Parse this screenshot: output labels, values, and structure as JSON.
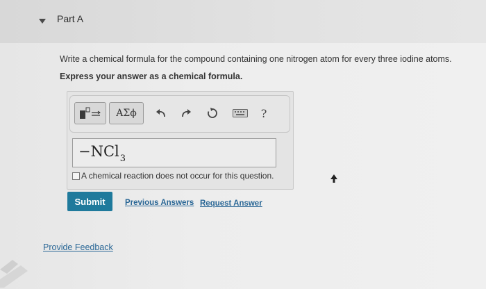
{
  "part": {
    "title": "Part A"
  },
  "question": {
    "text": "Write a chemical formula for the compound containing one nitrogen atom for every three iodine atoms.",
    "instruction": "Express your answer as a chemical formula."
  },
  "toolbar": {
    "symbols_label": "ΑΣϕ",
    "help_label": "?"
  },
  "answer": {
    "prefix": "−NCl",
    "subscript": "3"
  },
  "no_reaction_label": "A chemical reaction does not occur for this question.",
  "actions": {
    "submit_label": "Submit",
    "previous_answers_label": "Previous Answers",
    "request_answer_label": "Request Answer"
  },
  "footer": {
    "feedback_label": "Provide Feedback"
  },
  "colors": {
    "submit_bg": "#1f7a9c",
    "link": "#2a6796"
  }
}
